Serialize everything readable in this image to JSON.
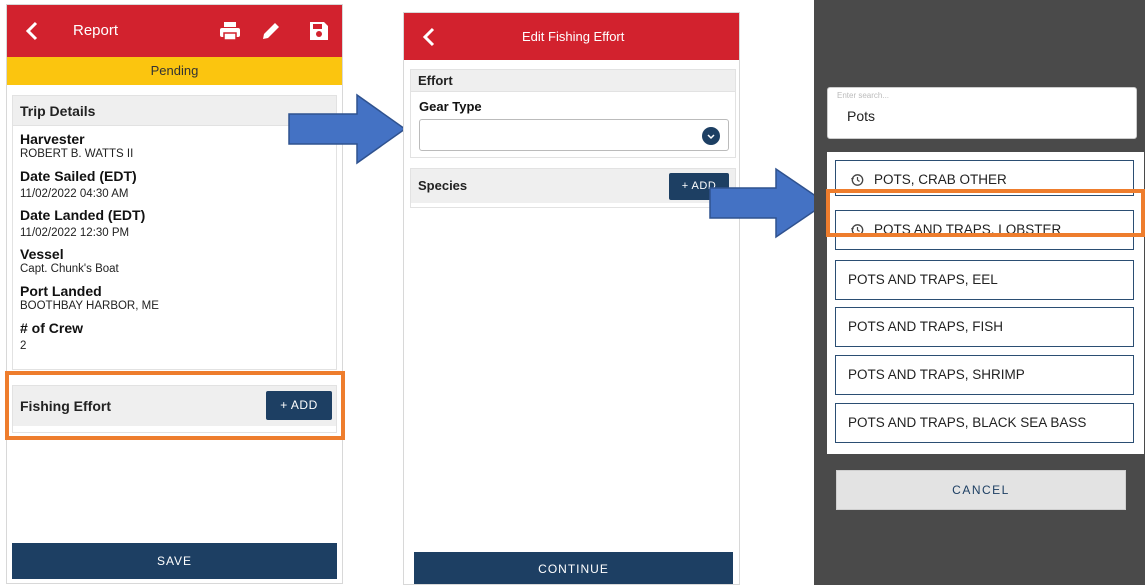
{
  "screen1": {
    "header_title": "Report",
    "status": "Pending",
    "trip_details": {
      "title": "Trip Details",
      "fields": [
        {
          "label": "Harvester",
          "value": "ROBERT B. WATTS II"
        },
        {
          "label": "Date Sailed (EDT)",
          "value": "11/02/2022 04:30 AM"
        },
        {
          "label": "Date Landed (EDT)",
          "value": "11/02/2022 12:30 PM"
        },
        {
          "label": "Vessel",
          "value": "Capt. Chunk's Boat"
        },
        {
          "label": "Port Landed",
          "value": "BOOTHBAY HARBOR, ME"
        },
        {
          "label": "# of Crew",
          "value": "2"
        }
      ]
    },
    "fishing_effort": {
      "title": "Fishing Effort",
      "add_label": "+ ADD"
    },
    "save_label": "SAVE"
  },
  "screen2": {
    "header_title": "Edit Fishing Effort",
    "effort_title": "Effort",
    "gear_type_label": "Gear Type",
    "gear_type_value": "",
    "species_title": "Species",
    "add_label": "+ ADD",
    "continue_label": "CONTINUE"
  },
  "screen3": {
    "search_placeholder": "Enter search...",
    "search_value": "Pots",
    "options": [
      {
        "label": "POTS, CRAB OTHER",
        "recent": true
      },
      {
        "label": "POTS AND TRAPS, LOBSTER",
        "recent": true
      },
      {
        "label": "POTS AND TRAPS, EEL",
        "recent": false
      },
      {
        "label": "POTS AND TRAPS, FISH",
        "recent": false
      },
      {
        "label": "POTS AND TRAPS, SHRIMP",
        "recent": false
      },
      {
        "label": "POTS AND TRAPS, BLACK SEA BASS",
        "recent": false
      }
    ],
    "cancel_label": "CANCEL"
  },
  "colors": {
    "header_red": "#d2222e",
    "pending_yellow": "#fbc50f",
    "navy": "#1d3f63",
    "highlight_orange": "#ee7d2d",
    "arrow_blue": "#4472c4"
  },
  "icons": [
    "back-chevron-icon",
    "print-icon",
    "edit-pencil-icon",
    "save-disk-icon",
    "dropdown-chevron-icon",
    "history-clock-icon"
  ]
}
